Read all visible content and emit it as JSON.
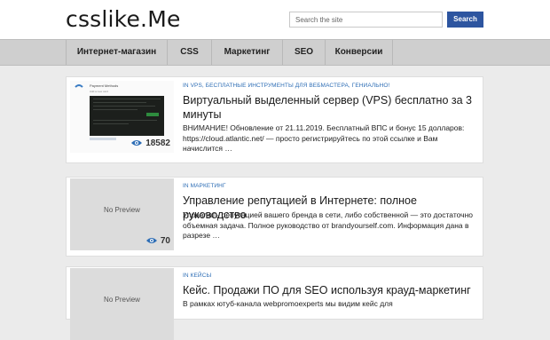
{
  "header": {
    "logo": "csslike.Me",
    "search_placeholder": "Search the site",
    "search_button": "Search"
  },
  "nav": {
    "items": [
      "Интернет-магазин",
      "CSS",
      "Маркетинг",
      "SEO",
      "Конверсии"
    ]
  },
  "posts": [
    {
      "categories": "IN VPS, БЕСПЛАТНЫЕ ИНСТРУМЕНТЫ ДЛЯ ВЕБМАСТЕРА, ГЕНИАЛЬНО!",
      "title": "Виртуальный выделенный сервер (VPS) бесплатно за 3 минуты",
      "excerpt": "ВНИМАНИЕ! Обновление от 21.11.2019. Бесплатный ВПС и бонус 15 долларов: https://cloud.atlantic.net/  — просто регистрируйтесь по этой ссылке и Вам начислится …",
      "views": "18582",
      "thumb_title": "Payment Methods",
      "thumb_sub": "Add a new card"
    },
    {
      "categories": "IN МАРКЕТИНГ",
      "title": "Управление репутацией в Интернете: полное руководство",
      "excerpt": "Управлять репутацией вашего бренда в сети, либо собственной — это достаточно объемная задача. Полное руководство от brandyourself.com. Информация дана в разрезе …",
      "views": "70",
      "thumb_text": "No Preview"
    },
    {
      "categories": "IN КЕЙСЫ",
      "title": "Кейс. Продажи ПО для SEO используя крауд-маркетинг",
      "excerpt": "В рамках ютуб-канала webpromoexperts мы видим кейс для",
      "thumb_text": "No Preview"
    }
  ],
  "colors": {
    "accent": "#2d55a0",
    "category": "#2d6db5",
    "background": "#ebebeb",
    "nav": "#cfcfcf"
  }
}
